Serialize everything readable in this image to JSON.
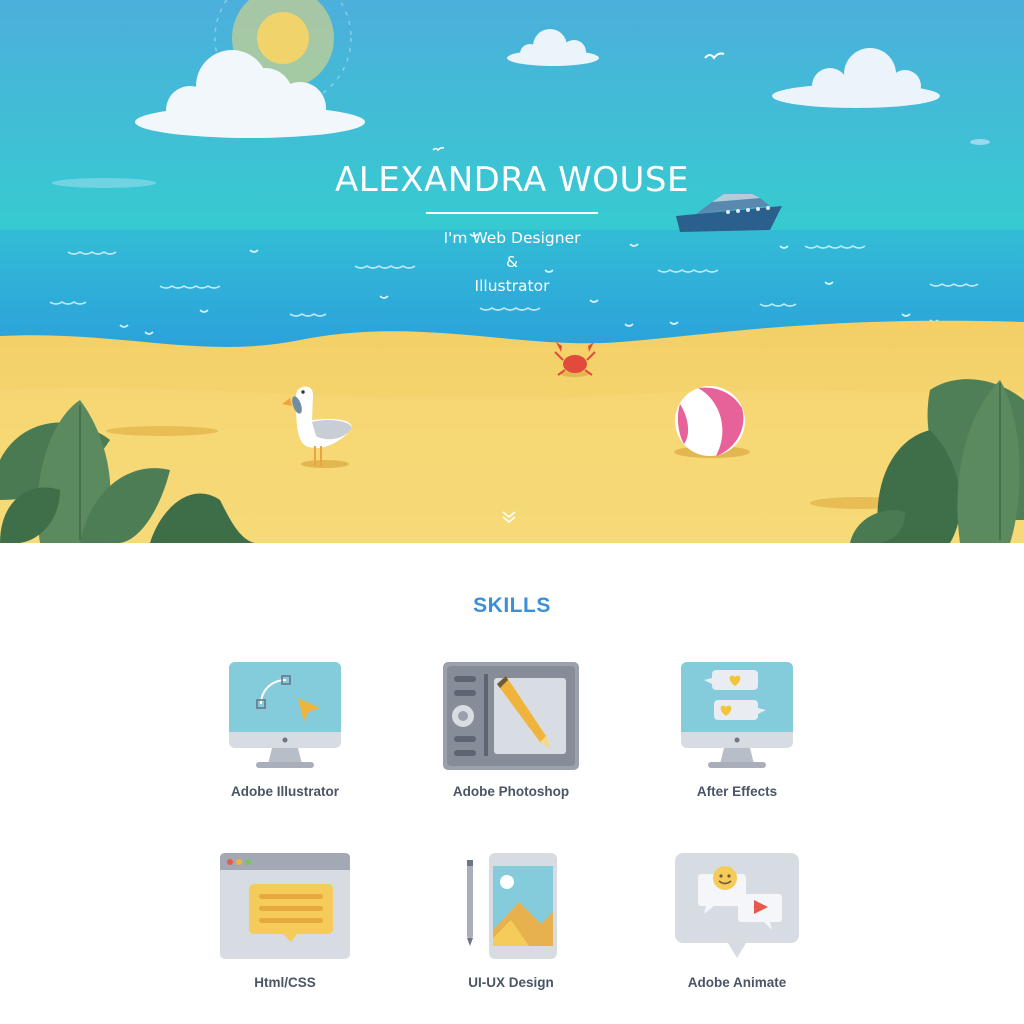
{
  "hero": {
    "name": "ALEXANDRA WOUSE",
    "subtitle_line1": "I'm Web Designer",
    "subtitle_line2": "&",
    "subtitle_line3": "Illustrator"
  },
  "skills": {
    "title": "SKILLS",
    "items": [
      {
        "label": "Adobe Illustrator",
        "icon": "monitor-pen-tool-icon"
      },
      {
        "label": "Adobe Photoshop",
        "icon": "drawing-tablet-icon"
      },
      {
        "label": "After Effects",
        "icon": "monitor-chat-hearts-icon"
      },
      {
        "label": "Html/CSS",
        "icon": "browser-window-icon"
      },
      {
        "label": "UI-UX Design",
        "icon": "phone-image-icon"
      },
      {
        "label": "Adobe Animate",
        "icon": "chat-bubbles-icon"
      }
    ]
  },
  "colors": {
    "sky_top": "#4fb3d9",
    "sea": "#2fa8d8",
    "sand": "#f4d06a",
    "skills_title": "#3a8fd6",
    "label_text": "#4a5566"
  }
}
